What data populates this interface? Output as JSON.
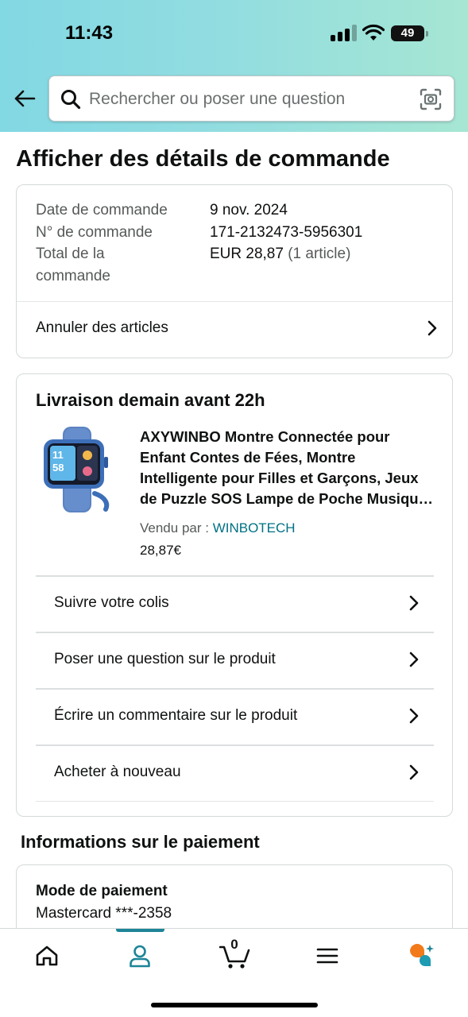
{
  "status_bar": {
    "time": "11:43",
    "battery": "49"
  },
  "search": {
    "placeholder": "Rechercher ou poser une question"
  },
  "page_title": "Afficher des détails de commande",
  "order_summary": {
    "date_label": "Date de commande",
    "date_value": "9 nov. 2024",
    "number_label": "N° de commande",
    "number_value": "171-2132473-5956301",
    "total_label_line1": "Total de la",
    "total_label_line2": "commande",
    "total_value": "EUR 28,87",
    "total_items": "(1 article)",
    "cancel_label": "Annuler des articles"
  },
  "delivery": {
    "title": "Livraison demain avant 22h",
    "product_title": "AXYWINBO Montre Connectée pour Enfant Contes de Fées, Montre Intelligente pour Filles et Garçons, Jeux de Puzzle SOS Lampe de Poche Musique Caméra",
    "sold_by_label": "Vendu par  : ",
    "seller": "WINBOTECH",
    "price": "28,87€",
    "watch_time_hour": "11",
    "watch_time_min": "58",
    "actions": [
      {
        "label": "Suivre votre colis"
      },
      {
        "label": "Poser une question sur le produit"
      },
      {
        "label": "Écrire un commentaire sur le produit"
      },
      {
        "label": "Acheter à nouveau"
      }
    ]
  },
  "payment": {
    "section_title": "Informations sur le paiement",
    "method_label": "Mode de paiement",
    "method_value": "Mastercard  ***-2358"
  },
  "bottom_nav": {
    "cart_count": "0",
    "active_item": "account",
    "accent_color": "#1d8597"
  },
  "colors": {
    "header_gradient_start": "#82d8e3",
    "header_gradient_end": "#a6e6d3",
    "link_color": "#007185"
  }
}
